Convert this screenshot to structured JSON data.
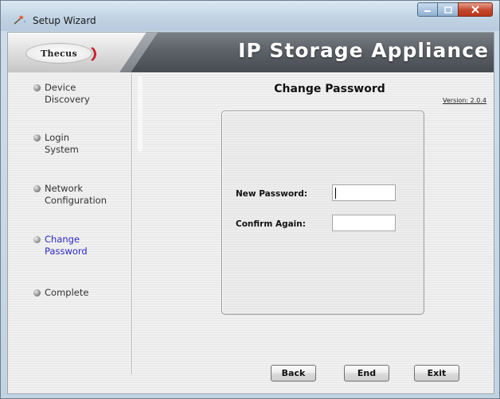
{
  "window": {
    "title": "Setup Wizard"
  },
  "banner": {
    "logo_text": "Thecus",
    "title": "IP Storage Appliance"
  },
  "sidebar": {
    "steps": [
      {
        "label_line1": "Device",
        "label_line2": "Discovery",
        "active": false
      },
      {
        "label_line1": "Login",
        "label_line2": "System",
        "active": false
      },
      {
        "label_line1": "Network",
        "label_line2": "Configuration",
        "active": false
      },
      {
        "label_line1": "Change",
        "label_line2": "Password",
        "active": true
      },
      {
        "label_line1": "Complete",
        "label_line2": "",
        "active": false
      }
    ]
  },
  "main": {
    "title": "Change Password",
    "version": "Version: 2.0.4",
    "fields": [
      {
        "label": "New Password:",
        "value": ""
      },
      {
        "label": "Confirm Again:",
        "value": ""
      }
    ]
  },
  "buttons": {
    "back": "Back",
    "end": "End",
    "exit": "Exit"
  },
  "colors": {
    "active_step": "#2d2ac4",
    "banner_text": "#ffffff",
    "close_button": "#c4452a"
  }
}
